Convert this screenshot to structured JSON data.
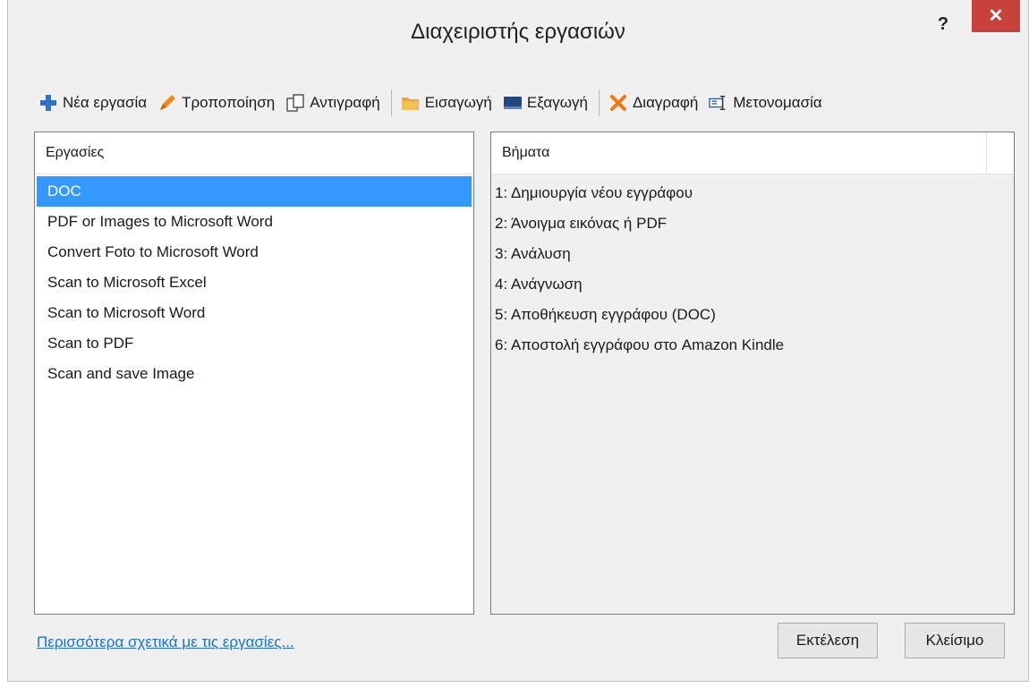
{
  "window": {
    "title": "Διαχειριστής εργασιών",
    "help": "?",
    "close": "✕"
  },
  "toolbar": {
    "new": "Νέα εργασία",
    "edit": "Τροποποίηση",
    "copy": "Αντιγραφή",
    "import": "Εισαγωγή",
    "export": "Εξαγωγή",
    "delete": "Διαγραφή",
    "rename": "Μετονομασία"
  },
  "tasks": {
    "header": "Εργασίες",
    "items": [
      "DOC",
      "PDF or Images to Microsoft Word",
      "Convert Foto to Microsoft Word",
      "Scan to Microsoft Excel",
      "Scan to Microsoft Word",
      "Scan to PDF",
      "Scan and save Image"
    ],
    "selected_index": 0
  },
  "steps": {
    "header": "Βήματα",
    "items": [
      "1: Δημιουργία νέου εγγράφου",
      "2: Άνοιγμα εικόνας ή PDF",
      "3: Ανάλυση",
      "4: Ανάγνωση",
      "5: Αποθήκευση εγγράφου (DOC)",
      "6: Αποστολή εγγράφου στο Amazon Kindle"
    ]
  },
  "footer": {
    "link": "Περισσότερα σχετικά με τις εργασίες...",
    "run": "Εκτέλεση",
    "close": "Κλείσιμο"
  },
  "colors": {
    "selection": "#3399ff",
    "close_button": "#c7423a",
    "link": "#1e6fd0"
  },
  "icons": {
    "new": "plus-icon",
    "edit": "pencil-icon",
    "copy": "copy-icon",
    "import": "folder-icon",
    "export": "export-icon",
    "delete": "delete-icon",
    "rename": "rename-icon"
  }
}
